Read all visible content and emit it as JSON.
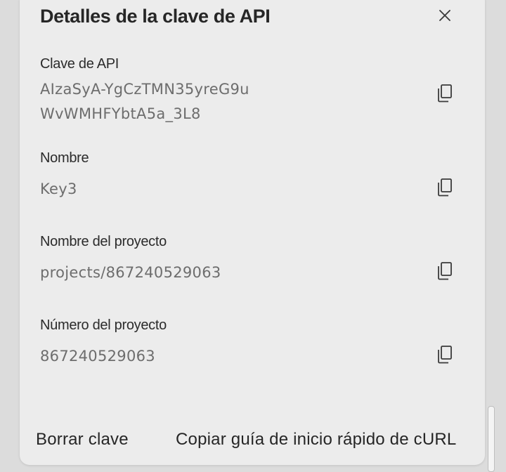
{
  "dialog": {
    "title": "Detalles de la clave de API",
    "close_icon": "close-icon"
  },
  "fields": [
    {
      "label": "Clave de API",
      "value": "AIzaSyA-YgCzTMN35yreG9uWvWMHFYbtA5a_3L8",
      "icon": "copy-icon"
    },
    {
      "label": "Nombre",
      "value": "Key3",
      "icon": "copy-icon"
    },
    {
      "label": "Nombre del proyecto",
      "value": "projects/867240529063",
      "icon": "copy-icon"
    },
    {
      "label": "Número del proyecto",
      "value": "867240529063",
      "icon": "copy-icon"
    }
  ],
  "footer": {
    "delete_label": "Borrar clave",
    "copy_curl_label": "Copiar guía de inicio rápido de cURL"
  },
  "colors": {
    "background": "#ececec",
    "text_primary": "#262626",
    "text_value": "#6d6d6d"
  }
}
